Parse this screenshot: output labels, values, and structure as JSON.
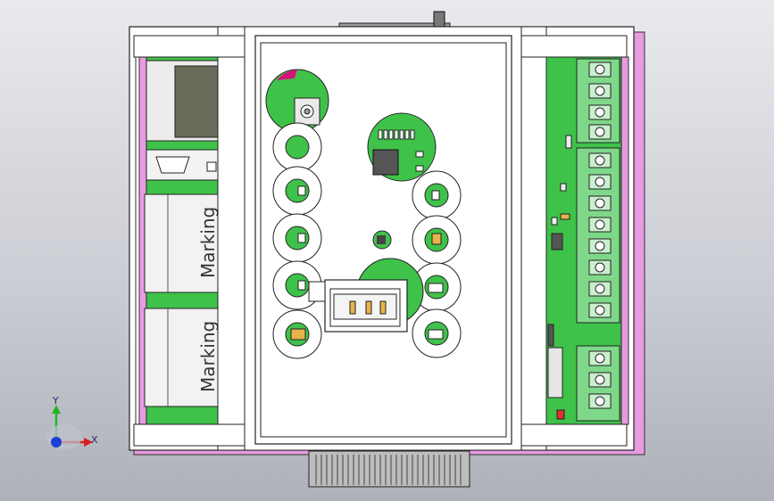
{
  "view": {
    "marking_text_upper": "Marking",
    "marking_text_lower": "Marking",
    "triad": {
      "y_label": "Y",
      "x_label": "X"
    }
  },
  "colors": {
    "background_top": "#e9eaee",
    "background_bottom": "#aeb1b9",
    "housing_pink": "#e79be0",
    "pcb_green": "#3fc24a",
    "terminal_green": "#7fd88a",
    "housing_white": "#ffffff",
    "edge_dark": "#222222",
    "axis_x": "#d62020",
    "axis_y": "#22b522",
    "axis_z": "#1a3fd6"
  }
}
